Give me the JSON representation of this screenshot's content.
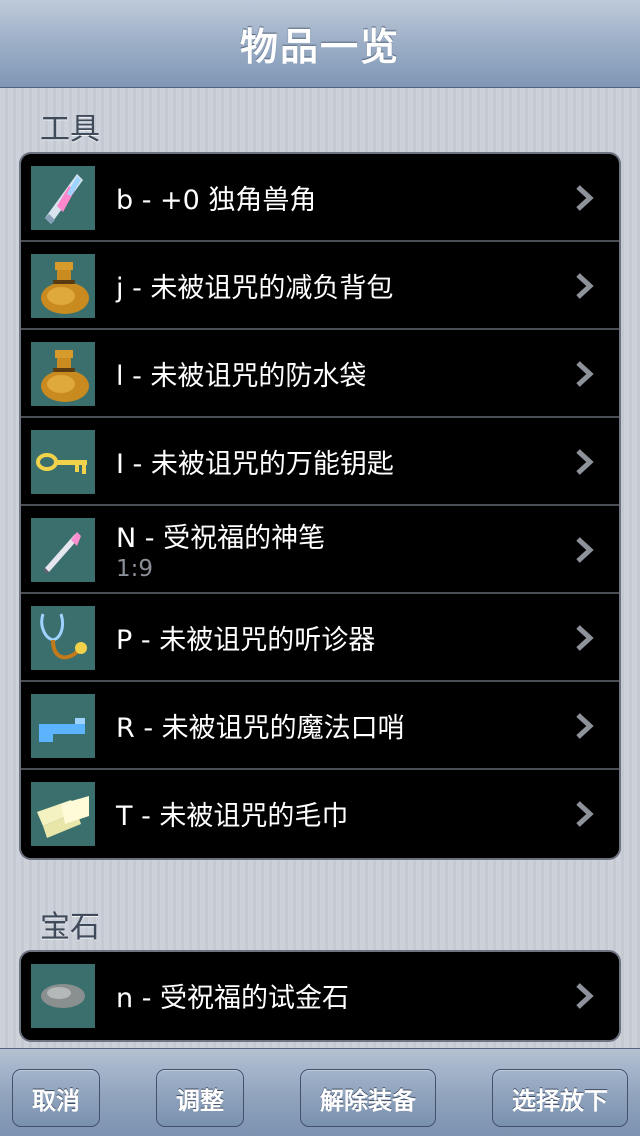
{
  "nav": {
    "title": "物品一览"
  },
  "sections": [
    {
      "header": "工具",
      "items": [
        {
          "icon": "unicorn-horn-icon",
          "label": "b - +0 独角兽角",
          "sub": ""
        },
        {
          "icon": "bag-icon",
          "label": "j - 未被诅咒的减负背包",
          "sub": ""
        },
        {
          "icon": "bag-icon",
          "label": "l - 未被诅咒的防水袋",
          "sub": ""
        },
        {
          "icon": "key-icon",
          "label": "I - 未被诅咒的万能钥匙",
          "sub": ""
        },
        {
          "icon": "marker-icon",
          "label": "N - 受祝福的神笔",
          "sub": "1:9"
        },
        {
          "icon": "stethoscope-icon",
          "label": "P - 未被诅咒的听诊器",
          "sub": ""
        },
        {
          "icon": "whistle-icon",
          "label": "R - 未被诅咒的魔法口哨",
          "sub": ""
        },
        {
          "icon": "towel-icon",
          "label": "T - 未被诅咒的毛巾",
          "sub": ""
        }
      ]
    },
    {
      "header": "宝石",
      "items": [
        {
          "icon": "gray-stone-icon",
          "label": "n - 受祝福的试金石",
          "sub": ""
        }
      ]
    }
  ],
  "toolbar": {
    "cancel": "取消",
    "adjust": "调整",
    "unequip": "解除装备",
    "select_drop": "选择放下"
  },
  "colors": {
    "thumb_bg": "#3b6f6e",
    "nav_accent": "#7f97b5"
  }
}
